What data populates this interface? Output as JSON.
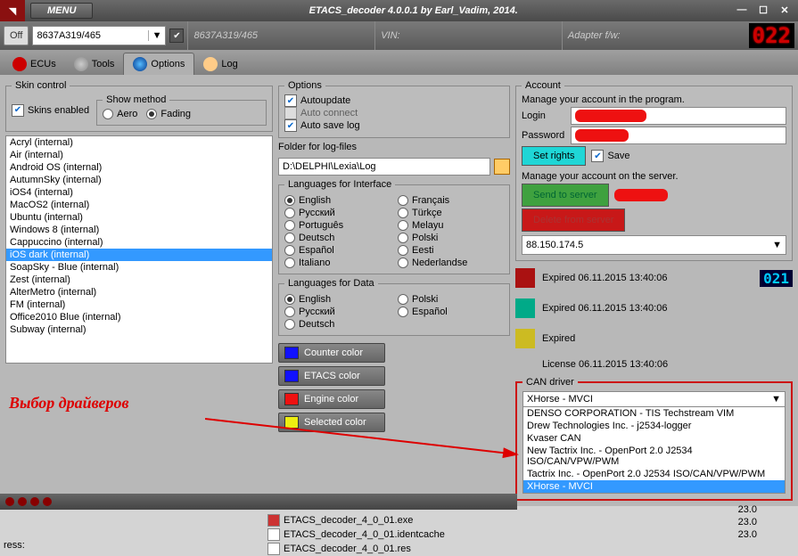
{
  "titlebar": {
    "menu": "MENU",
    "title": "ETACS_decoder 4.0.0.1 by Earl_Vadim, 2014.",
    "min": "—",
    "max": "☐",
    "close": "✕"
  },
  "infobar": {
    "off": "Off",
    "combo": "8637A319/465",
    "cell1": "8637A319/465",
    "cell2": "VIN:",
    "cell3": "Adapter f/w:",
    "seg": "022"
  },
  "tabs": {
    "ecus": "ECUs",
    "tools": "Tools",
    "options": "Options",
    "log": "Log"
  },
  "skin": {
    "legend": "Skin control",
    "enabled": "Skins enabled",
    "show_legend": "Show method",
    "aero": "Aero",
    "fading": "Fading",
    "items": [
      "Acryl (internal)",
      "Air (internal)",
      "Android OS (internal)",
      "AutumnSky (internal)",
      "iOS4 (internal)",
      "MacOS2 (internal)",
      "Ubuntu (internal)",
      "Windows 8 (internal)",
      "Cappuccino (internal)",
      "iOS dark (internal)",
      "SoapSky - Blue (internal)",
      "Zest (internal)",
      "AlterMetro (internal)",
      "FM (internal)",
      "Office2010 Blue (internal)",
      "Subway (internal)"
    ],
    "selected_index": 9
  },
  "annot": "Выбор драйверов",
  "options": {
    "legend": "Options",
    "autoupdate": "Autoupdate",
    "autoconnect": "Auto connect",
    "autosave": "Auto save log",
    "folder_label": "Folder for log-files",
    "folder": "D:\\DELPHI\\Lexia\\Log"
  },
  "lang_if": {
    "legend": "Languages for Interface",
    "items": [
      "English",
      "Français",
      "Русский",
      "Türkçe",
      "Português",
      "Melayu",
      "Deutsch",
      "Polski",
      "Español",
      "Eesti",
      "Italiano",
      "Nederlandse"
    ],
    "selected": "English"
  },
  "lang_data": {
    "legend": "Languages for Data",
    "items": [
      "English",
      "Polski",
      "Русский",
      "Español",
      "Deutsch"
    ],
    "selected": "English"
  },
  "colors": {
    "counter": "Counter color",
    "etacs": "ETACS color",
    "engine": "Engine color",
    "selected": "Selected color"
  },
  "account": {
    "legend": "Account",
    "info": "Manage your account in the program.",
    "login": "Login",
    "password": "Password",
    "setrights": "Set rights",
    "save": "Save",
    "server_info": "Manage your account on the server.",
    "send": "Send to server",
    "delete": "Delete from server",
    "ip": "88.150.174.5"
  },
  "status": {
    "s1": "Expired 06.11.2015 13:40:06",
    "s2": "Expired 06.11.2015 13:40:06",
    "s3": "Expired",
    "lic": "License 06.11.2015 13:40:06",
    "seg": "021"
  },
  "can": {
    "legend": "CAN driver",
    "value": "XHorse - MVCI",
    "options": [
      "DENSO CORPORATION - TIS Techstream VIM",
      "Drew Technologies Inc. - j2534-logger",
      "Kvaser CAN",
      "New Tactrix Inc. - OpenPort 2.0 J2534 ISO/CAN/VPW/PWM",
      "Tactrix Inc. - OpenPort 2.0 J2534 ISO/CAN/VPW/PWM",
      "XHorse - MVCI"
    ]
  },
  "files": {
    "f1": "ETACS_decoder_4_0_01.exe",
    "f2": "ETACS_decoder_4_0_01.identcache",
    "f3": "ETACS_decoder_4_0_01.res",
    "t1": "23.0",
    "t2": "23.0",
    "t3": "23.0"
  },
  "desk": "ress:"
}
